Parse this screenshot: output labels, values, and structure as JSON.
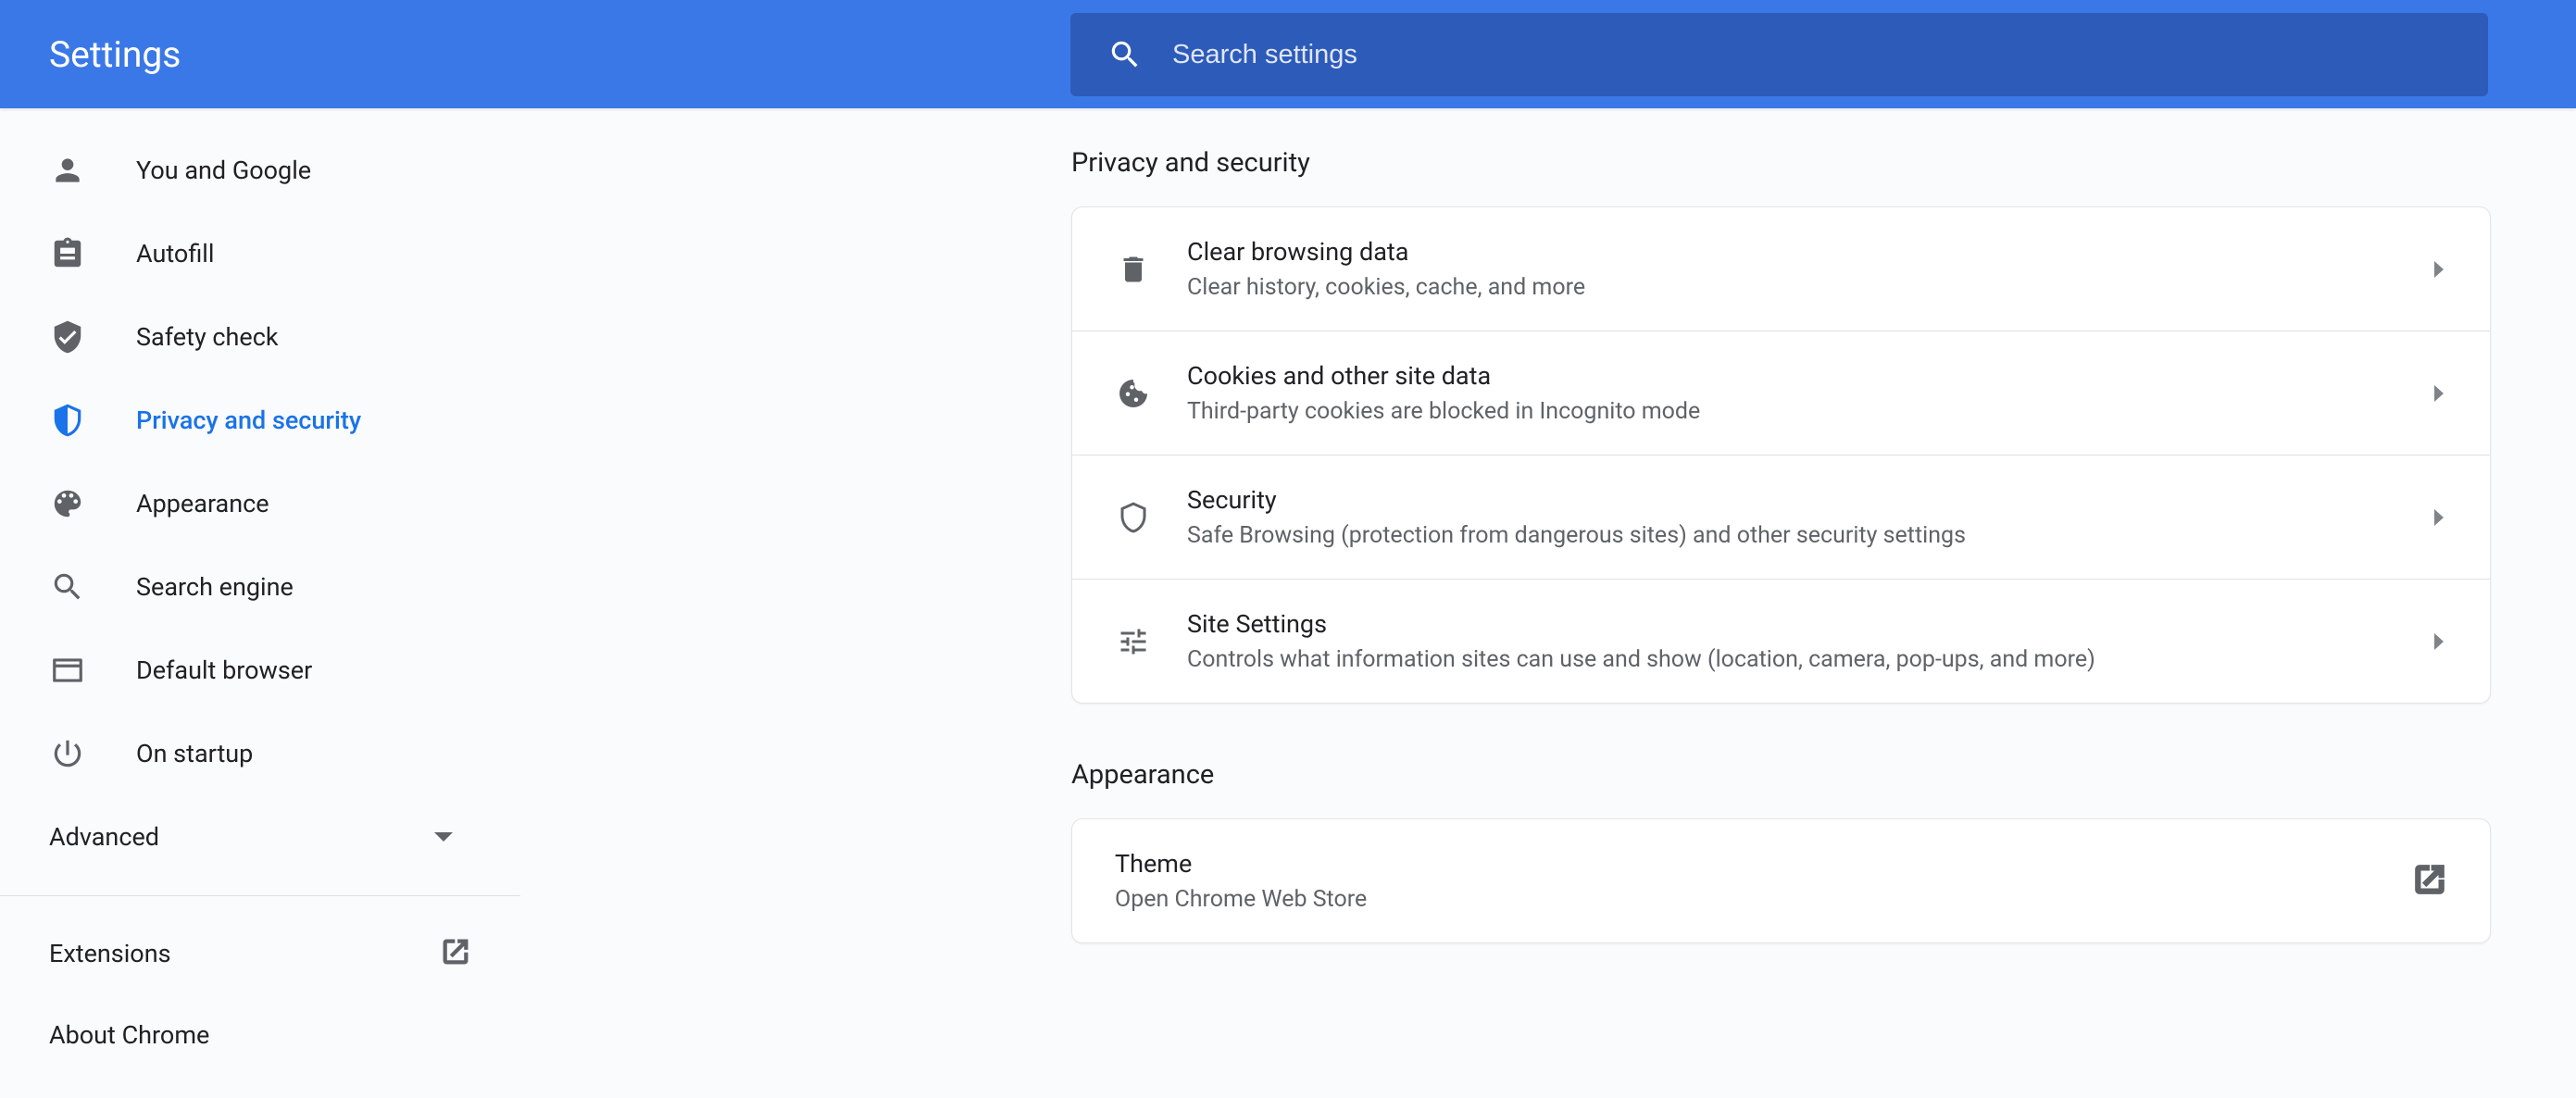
{
  "header": {
    "title": "Settings",
    "search_placeholder": "Search settings"
  },
  "sidebar": {
    "items": [
      {
        "icon": "person-icon",
        "label": "You and Google"
      },
      {
        "icon": "clipboard-icon",
        "label": "Autofill"
      },
      {
        "icon": "shield-check-icon",
        "label": "Safety check"
      },
      {
        "icon": "shield-icon",
        "label": "Privacy and security",
        "active": true
      },
      {
        "icon": "palette-icon",
        "label": "Appearance"
      },
      {
        "icon": "search-icon",
        "label": "Search engine"
      },
      {
        "icon": "browser-icon",
        "label": "Default browser"
      },
      {
        "icon": "power-icon",
        "label": "On startup"
      }
    ],
    "advanced_label": "Advanced",
    "footer": [
      {
        "label": "Extensions",
        "external": true
      },
      {
        "label": "About Chrome",
        "external": false
      }
    ]
  },
  "main": {
    "sections": [
      {
        "title": "Privacy and security",
        "rows": [
          {
            "icon": "trash-icon",
            "title": "Clear browsing data",
            "sub": "Clear history, cookies, cache, and more",
            "arrow": true
          },
          {
            "icon": "cookie-icon",
            "title": "Cookies and other site data",
            "sub": "Third-party cookies are blocked in Incognito mode",
            "arrow": true
          },
          {
            "icon": "shield-outline-icon",
            "title": "Security",
            "sub": "Safe Browsing (protection from dangerous sites) and other security settings",
            "arrow": true
          },
          {
            "icon": "tune-icon",
            "title": "Site Settings",
            "sub": "Controls what information sites can use and show (location, camera, pop-ups, and more)",
            "arrow": true
          }
        ]
      },
      {
        "title": "Appearance",
        "rows": [
          {
            "icon": "",
            "title": "Theme",
            "sub": "Open Chrome Web Store",
            "external": true
          }
        ]
      }
    ]
  }
}
